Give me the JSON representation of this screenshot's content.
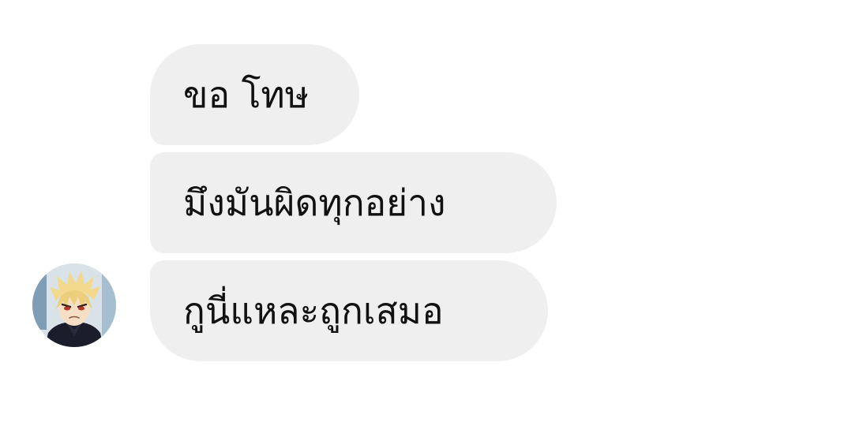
{
  "conversation": {
    "messages": [
      {
        "text": "ขอ โทษ"
      },
      {
        "text": "มึงมันผิดทุกอย่าง"
      },
      {
        "text": "กูนี่แหละถูกเสมอ"
      }
    ],
    "avatar": {
      "icon": "anime-character-avatar-icon",
      "hair_color": "#f3d98e",
      "outfit_color": "#1c1d2a"
    },
    "bubble_color": "#efefef",
    "text_color": "#111111"
  }
}
